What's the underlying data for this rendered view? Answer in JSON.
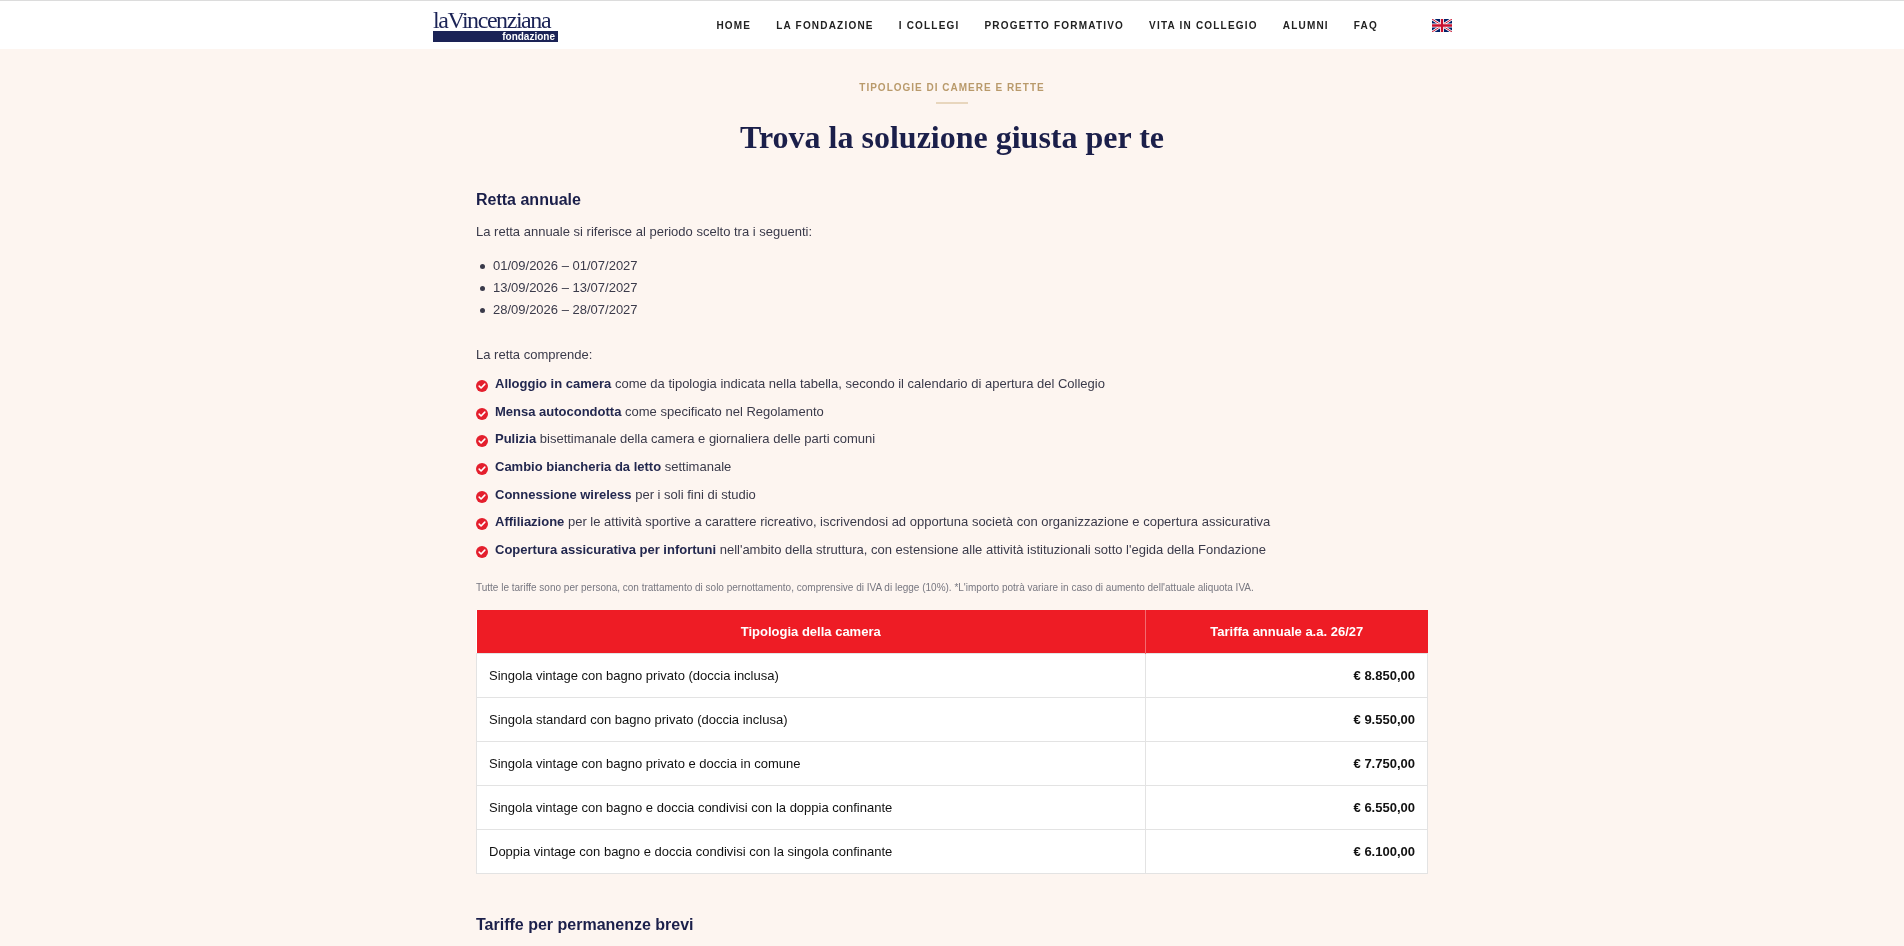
{
  "header": {
    "logo": {
      "wordmark": "laVincenziana",
      "tagline": "fondazione"
    },
    "nav": [
      {
        "label": "HOME"
      },
      {
        "label": "LA FONDAZIONE"
      },
      {
        "label": "I COLLEGI"
      },
      {
        "label": "PROGETTO FORMATIVO"
      },
      {
        "label": "VITA IN COLLEGIO"
      },
      {
        "label": "ALUMNI"
      },
      {
        "label": "FAQ"
      }
    ]
  },
  "intro": {
    "eyebrow": "TIPOLOGIE DI CAMERE E RETTE",
    "title": "Trova la soluzione giusta per te"
  },
  "annual_fee": {
    "heading": "Retta annuale",
    "description": "La retta annuale si riferisce al periodo scelto tra i seguenti:",
    "periods": [
      "01/09/2026 – 01/07/2027",
      "13/09/2026 – 13/07/2027",
      "28/09/2026 – 28/07/2027"
    ],
    "includes_label": "La retta comprende:",
    "includes": [
      "**Alloggio in camera** come da tipologia indicata nella tabella, secondo il calendario di apertura del Collegio",
      "**Mensa autocondotta** come specificato nel Regolamento",
      "**Pulizia** bisettimanale della camera e giornaliera delle parti comuni",
      "**Cambio biancheria da letto** settimanale",
      "**Connessione wireless** per i soli fini di studio",
      "**Affiliazione** per le attività sportive a carattere ricreativo, iscrivendosi ad opportuna società con organizzazione e copertura assicurativa",
      "**Copertura assicurativa per infortuni** nell'ambito della struttura, con estensione alle attività istituzionali sotto l'egida della Fondazione"
    ],
    "footnote": "Tutte le tariffe sono per persona, con trattamento di solo pernottamento, comprensive di IVA di legge (10%). *L'importo potrà variare in caso di aumento dell'attuale aliquota IVA."
  },
  "table": {
    "columns": [
      "Tipologia della camera",
      "Tariffa annuale a.a. 26/27"
    ],
    "rows": [
      {
        "room_type": "Singola vintage con bagno privato (doccia inclusa)",
        "price": "€ 8.850,00"
      },
      {
        "room_type": "Singola standard con bagno privato (doccia inclusa)",
        "price": "€ 9.550,00"
      },
      {
        "room_type": "Singola vintage con bagno privato e doccia in comune",
        "price": "€ 7.750,00"
      },
      {
        "room_type": "Singola vintage con bagno e doccia condivisi con la doppia confinante",
        "price": "€ 6.550,00"
      },
      {
        "room_type": "Doppia vintage con bagno e doccia condivisi con la singola confinante",
        "price": "€ 6.100,00"
      }
    ]
  },
  "next_section": {
    "heading": "Tariffe per permanenze brevi"
  }
}
